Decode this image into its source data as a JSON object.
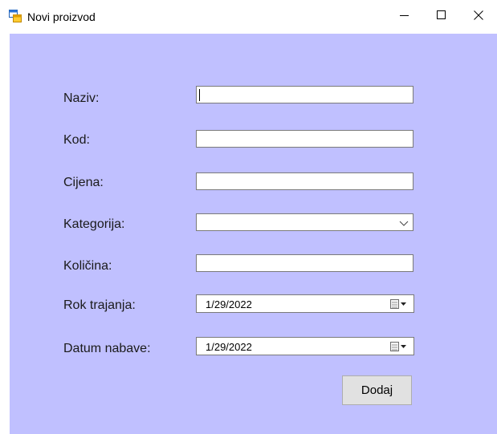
{
  "window": {
    "title": "Novi proizvod",
    "icons": {
      "app": "form-icon",
      "minimize": "minimize-icon",
      "maximize": "maximize-icon",
      "close": "close-icon"
    }
  },
  "form": {
    "fields": [
      {
        "label": "Naziv:",
        "value": ""
      },
      {
        "label": "Kod:",
        "value": ""
      },
      {
        "label": "Cijena:",
        "value": ""
      },
      {
        "label": "Kategorija:",
        "value": ""
      },
      {
        "label": "Količina:",
        "value": ""
      },
      {
        "label": "Rok trajanja:",
        "value": "1/29/2022"
      },
      {
        "label": "Datum nabave:",
        "value": "1/29/2022"
      }
    ],
    "submit_label": "Dodaj"
  },
  "colors": {
    "background": "#c0c0ff",
    "titlebar": "#ffffff"
  }
}
